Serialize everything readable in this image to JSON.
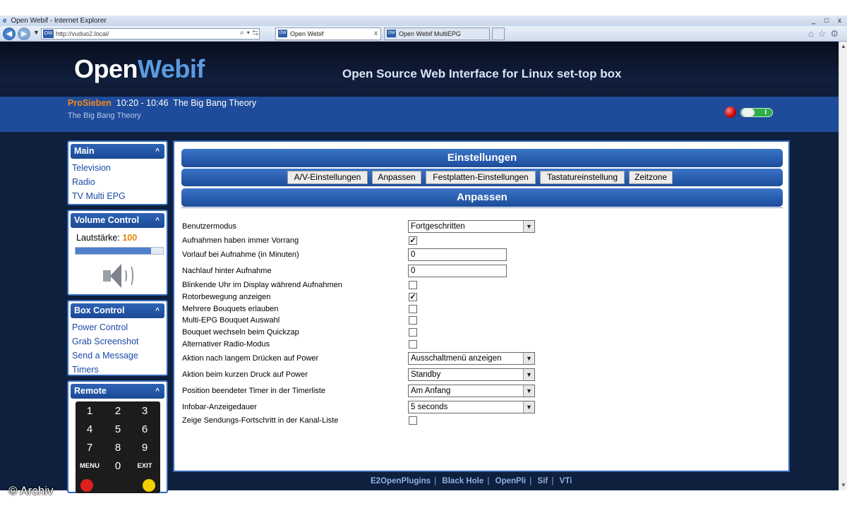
{
  "browser": {
    "window_title": "Open Webif - Internet Explorer",
    "window_buttons": "_ □ x",
    "url": "http://vuduo2.local/",
    "tabs": [
      {
        "label": "Open Webif",
        "close": "x"
      },
      {
        "label": "Open Webif MultiEPG"
      }
    ]
  },
  "header": {
    "logo_open": "Open",
    "logo_webif": "Webif",
    "tagline": "Open Source Web Interface for Linux set-top box"
  },
  "now_playing": {
    "channel": "ProSieben",
    "time": "10:20 - 10:46",
    "title": "The Big Bang Theory",
    "description": "The Big Bang Theory",
    "toggle_mark": "I"
  },
  "sidebar": {
    "main": {
      "title": "Main",
      "items": [
        "Television",
        "Radio",
        "TV Multi EPG"
      ]
    },
    "volume": {
      "title": "Volume Control",
      "label": "Lautstärke:",
      "value": "100",
      "level_fraction": 0.86
    },
    "box_control": {
      "title": "Box Control",
      "items": [
        "Power Control",
        "Grab Screenshot",
        "Send a Message",
        "Timers"
      ]
    },
    "remote": {
      "title": "Remote",
      "keys": [
        "1",
        "2",
        "3",
        "4",
        "5",
        "6",
        "7",
        "8",
        "9",
        "MENU",
        "0",
        "EXIT"
      ]
    }
  },
  "content": {
    "title": "Einstellungen",
    "tabs": [
      "A/V-Einstellungen",
      "Anpassen",
      "Festplatten-Einstellungen",
      "Tastatureinstellung",
      "Zeitzone"
    ],
    "subtitle": "Anpassen",
    "settings": [
      {
        "label": "Benutzermodus",
        "type": "select",
        "value": "Fortgeschritten"
      },
      {
        "label": "Aufnahmen haben immer Vorrang",
        "type": "checkbox",
        "checked": true
      },
      {
        "label": "Vorlauf bei Aufnahme (in Minuten)",
        "type": "text",
        "value": "0"
      },
      {
        "label": "Nachlauf hinter Aufnahme",
        "type": "text",
        "value": "0"
      },
      {
        "label": "Blinkende Uhr im Display während Aufnahmen",
        "type": "checkbox",
        "checked": false
      },
      {
        "label": "Rotorbewegung anzeigen",
        "type": "checkbox",
        "checked": true
      },
      {
        "label": "Mehrere Bouquets erlauben",
        "type": "checkbox",
        "checked": false
      },
      {
        "label": "Multi-EPG Bouquet Auswahl",
        "type": "checkbox",
        "checked": false
      },
      {
        "label": "Bouquet wechseln beim Quickzap",
        "type": "checkbox",
        "checked": false
      },
      {
        "label": "Alternativer Radio-Modus",
        "type": "checkbox",
        "checked": false
      },
      {
        "label": "Aktion nach langem Drücken auf Power",
        "type": "select",
        "value": "Ausschaltmenü anzeigen"
      },
      {
        "label": "Aktion beim kurzen Druck auf Power",
        "type": "select",
        "value": "Standby"
      },
      {
        "label": "Position beendeter Timer in der Timerliste",
        "type": "select",
        "value": "Am Anfang"
      },
      {
        "label": "Infobar-Anzeigedauer",
        "type": "select",
        "value": "5 seconds"
      },
      {
        "label": "Zeige Sendungs-Fortschritt in der Kanal-Liste",
        "type": "checkbox",
        "checked": false
      }
    ]
  },
  "footer": {
    "links": [
      "E2OpenPlugins",
      "Black Hole",
      "OpenPli",
      "Sif",
      "VTi"
    ]
  },
  "watermark": "© Archiv",
  "colors": {
    "accent": "#1f4c9a",
    "channel": "#f08a1a",
    "link": "#1c4aa8"
  }
}
